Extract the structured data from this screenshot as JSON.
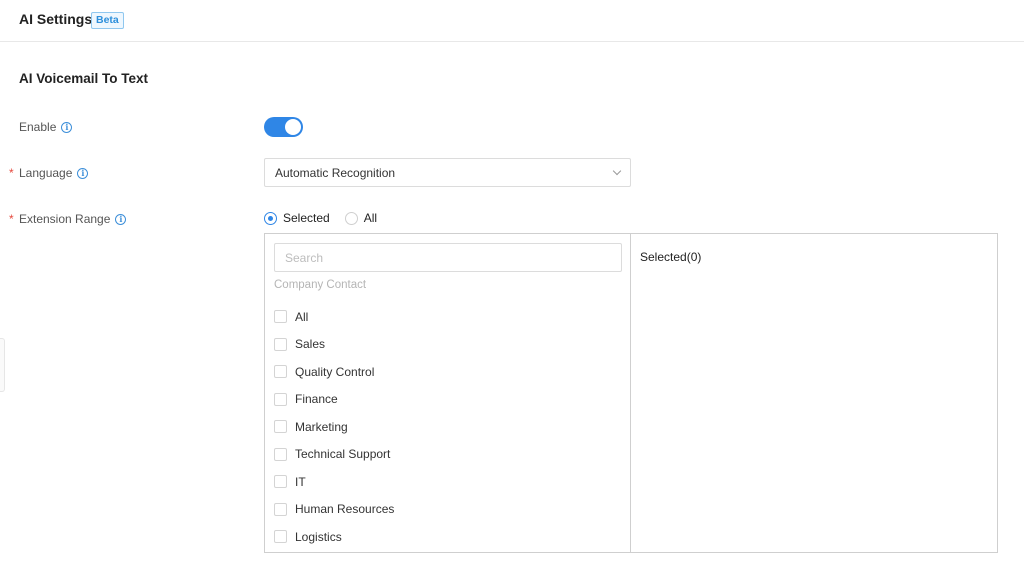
{
  "header": {
    "title": "AI Settings",
    "badge": "Beta"
  },
  "section": {
    "title": "AI Voicemail To Text"
  },
  "form": {
    "enable": {
      "label": "Enable",
      "value": true
    },
    "language": {
      "label": "Language",
      "required": true,
      "value": "Automatic Recognition"
    },
    "extension_range": {
      "label": "Extension Range",
      "required": true,
      "options": [
        "Selected",
        "All"
      ],
      "selected": "Selected"
    }
  },
  "transfer": {
    "search_placeholder": "Search",
    "group_heading": "Company Contact",
    "items": [
      {
        "label": "All",
        "checked": false
      },
      {
        "label": "Sales",
        "checked": false
      },
      {
        "label": "Quality Control",
        "checked": false
      },
      {
        "label": "Finance",
        "checked": false
      },
      {
        "label": "Marketing",
        "checked": false
      },
      {
        "label": "Technical Support",
        "checked": false
      },
      {
        "label": "IT",
        "checked": false
      },
      {
        "label": "Human Resources",
        "checked": false
      },
      {
        "label": "Logistics",
        "checked": false
      }
    ],
    "selected_label": "Selected(0)"
  },
  "colors": {
    "accent": "#2f86e6",
    "required": "#e5483d",
    "badge_text": "#2d8fdb"
  },
  "icons": {
    "info": "info-icon",
    "dropdown": "chevron-down-icon"
  }
}
